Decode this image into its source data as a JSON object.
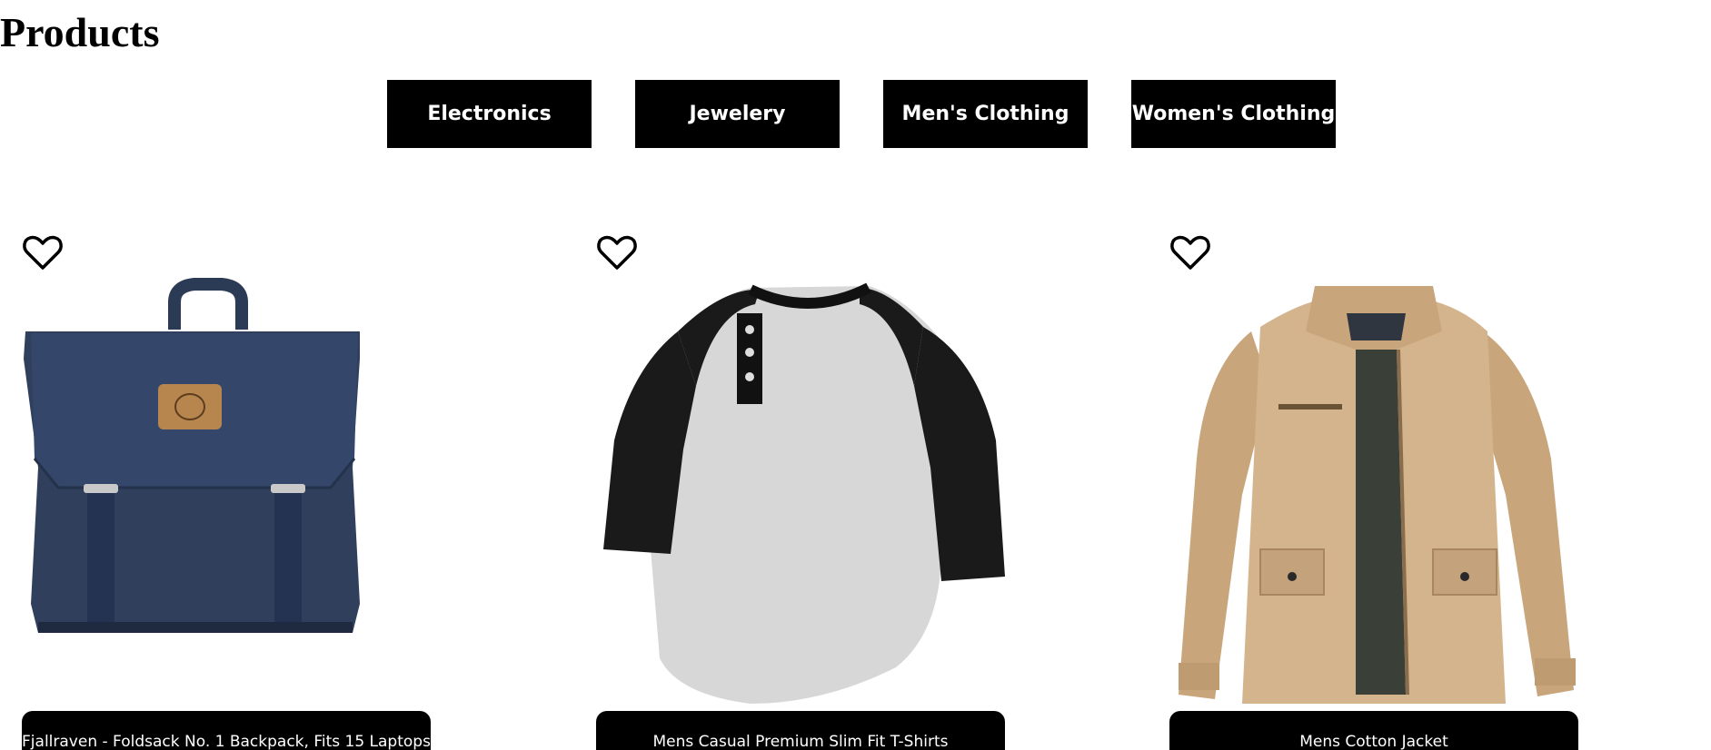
{
  "page": {
    "title": "Products"
  },
  "categories": [
    {
      "label": "Electronics"
    },
    {
      "label": "Jewelery"
    },
    {
      "label": "Men's Clothing"
    },
    {
      "label": "Women's Clothing"
    }
  ],
  "products": [
    {
      "title": "Fjallraven - Foldsack No. 1 Backpack, Fits 15 Laptops",
      "favorite": false,
      "image_icon": "backpack-image"
    },
    {
      "title": "Mens Casual Premium Slim Fit T-Shirts",
      "favorite": false,
      "image_icon": "tshirt-image"
    },
    {
      "title": "Mens Cotton Jacket",
      "favorite": false,
      "image_icon": "jacket-image"
    }
  ],
  "colors": {
    "button_bg": "#000000",
    "button_text": "#ffffff",
    "page_bg": "#ffffff"
  }
}
